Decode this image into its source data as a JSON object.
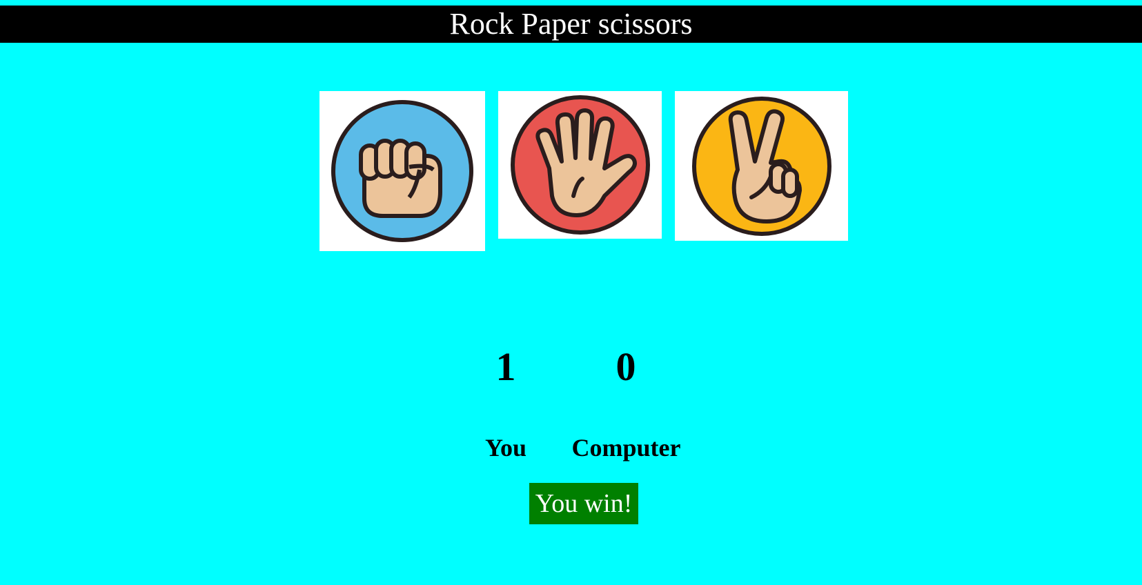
{
  "header": {
    "title": "Rock Paper scissors"
  },
  "choices": [
    {
      "id": "rock",
      "icon": "rock-fist-icon",
      "bg_color": "#5bbbe8"
    },
    {
      "id": "paper",
      "icon": "paper-hand-icon",
      "bg_color": "#e85550"
    },
    {
      "id": "scissors",
      "icon": "scissors-hand-icon",
      "bg_color": "#fbb614"
    }
  ],
  "scoreboard": {
    "user_score": "1",
    "computer_score": "0",
    "user_label": "You",
    "computer_label": "Computer"
  },
  "result": {
    "message": "You win!",
    "color": "#008000"
  },
  "colors": {
    "background": "#00ffff",
    "header": "#000000",
    "skin": "#ecc49a",
    "outline": "#2a1d1d"
  }
}
